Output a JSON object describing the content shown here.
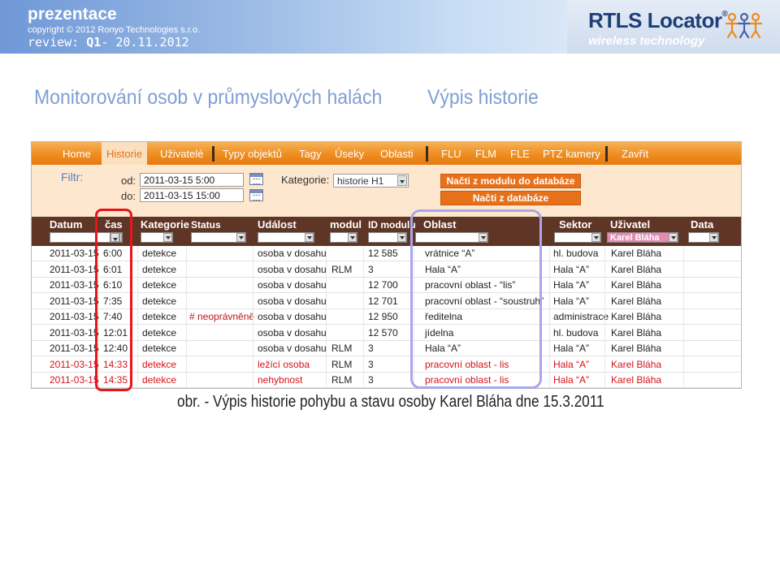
{
  "header": {
    "title": "prezentace",
    "copyright": "copyright © 2012   Ronyo Technologies s.r.o.",
    "review_prefix": "review: ",
    "review_q": "Q1",
    "review_date": "- 20.11.2012",
    "logo_main": "RTLS Locator",
    "logo_reg": "®",
    "logo_sub": "wireless technology"
  },
  "headline": {
    "main": "Monitorování osob v průmyslových halách",
    "side": "Výpis historie"
  },
  "nav": {
    "items": [
      "Home",
      "Historie",
      "Uživatelé",
      "Typy objektů",
      "Tagy",
      "Úseky",
      "Oblasti",
      "FLU",
      "FLM",
      "FLE",
      "PTZ kamery",
      "Zavřít"
    ],
    "active": "Historie"
  },
  "filter": {
    "label": "Filtr:",
    "from_label": "od:",
    "to_label": "do:",
    "from_value": "2011-03-15   5:00",
    "to_value": "2011-03-15   15:00",
    "category_label": "Kategorie:",
    "category_value": "historie H1",
    "btn_module": "Načti z modulu do databáze",
    "btn_db": "Načti z databáze"
  },
  "table": {
    "columns": [
      "Datum",
      "čas",
      "Kategorie",
      "Status",
      "Událost",
      "modul",
      "ID modulu",
      "Oblast",
      "Sektor",
      "Uživatel",
      "Data"
    ],
    "user_filter": "Karel Bláha",
    "rows": [
      {
        "datum": "2011-03-15",
        "cas": "6:00",
        "kategorie": "detekce",
        "status": "",
        "udalost": "osoba v dosahu",
        "modul": "",
        "id": "12 585",
        "oblast": "vrátnice “A”",
        "sektor": "hl. budova",
        "uzivatel": "Karel Bláha",
        "alarm": false
      },
      {
        "datum": "2011-03-15",
        "cas": "6:01",
        "kategorie": "detekce",
        "status": "",
        "udalost": "osoba v dosahu",
        "modul": "RLM",
        "id": "3",
        "oblast": "Hala “A”",
        "sektor": "Hala “A”",
        "uzivatel": "Karel Bláha",
        "alarm": false
      },
      {
        "datum": "2011-03-15",
        "cas": "6:10",
        "kategorie": "detekce",
        "status": "",
        "udalost": "osoba v dosahu",
        "modul": "",
        "id": "12 700",
        "oblast": "pracovní oblast - “lis”",
        "sektor": "Hala “A”",
        "uzivatel": "Karel Bláha",
        "alarm": false
      },
      {
        "datum": "2011-03-15",
        "cas": "7:35",
        "kategorie": "detekce",
        "status": "",
        "udalost": "osoba v dosahu",
        "modul": "",
        "id": "12 701",
        "oblast": "pracovní oblast - “soustruh”",
        "sektor": "Hala “A”",
        "uzivatel": "Karel Bláha",
        "alarm": false
      },
      {
        "datum": "2011-03-15",
        "cas": "7:40",
        "kategorie": "detekce",
        "status": "# neoprávněně",
        "udalost": "osoba v dosahu",
        "modul": "",
        "id": "12 950",
        "oblast": "ředitelna",
        "sektor": "administrace",
        "uzivatel": "Karel Bláha",
        "alarm": false
      },
      {
        "datum": "2011-03-15",
        "cas": "12:01",
        "kategorie": "detekce",
        "status": "",
        "udalost": "osoba v dosahu",
        "modul": "",
        "id": "12 570",
        "oblast": "jídelna",
        "sektor": "hl. budova",
        "uzivatel": "Karel Bláha",
        "alarm": false
      },
      {
        "datum": "2011-03-15",
        "cas": "12:40",
        "kategorie": "detekce",
        "status": "",
        "udalost": "osoba v dosahu",
        "modul": "RLM",
        "id": "3",
        "oblast": "Hala “A”",
        "sektor": "Hala “A”",
        "uzivatel": "Karel Bláha",
        "alarm": false
      },
      {
        "datum": "2011-03-15",
        "cas": "14:33",
        "kategorie": "detekce",
        "status": "",
        "udalost": "ležící osoba",
        "modul": "RLM",
        "id": "3",
        "oblast": "pracovní oblast - lis",
        "sektor": "Hala “A”",
        "uzivatel": "Karel Bláha",
        "alarm": true
      },
      {
        "datum": "2011-03-15",
        "cas": "14:35",
        "kategorie": "detekce",
        "status": "",
        "udalost": "nehybnost",
        "modul": "RLM",
        "id": "3",
        "oblast": "pracovní oblast - lis",
        "sektor": "Hala “A”",
        "uzivatel": "Karel Bláha",
        "alarm": true
      }
    ]
  },
  "caption": "obr. - Výpis historie pohybu a stavu osoby  Karel Bláha dne 15.3.2011",
  "colors": {
    "nav_orange": "#ef8d1f",
    "header_brown": "#5f3525",
    "alarm_red": "#d3141a",
    "status_red": "#c0141a",
    "highlight_red": "#e8151b",
    "highlight_blue": "#a9a7ea",
    "filter_bg": "#fde8cf"
  }
}
